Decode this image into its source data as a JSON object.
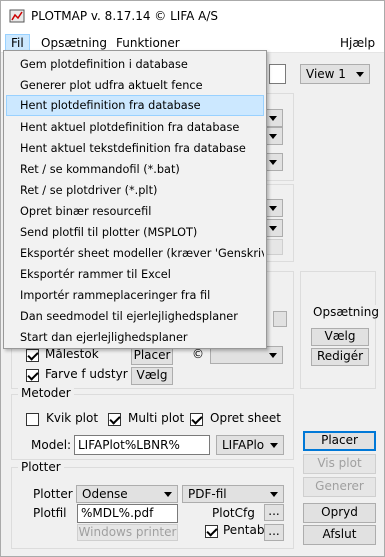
{
  "app": {
    "title": "PLOTMAP v. 8.17.14 © LIFA A/S"
  },
  "menu": {
    "items": [
      {
        "label": "Fil"
      },
      {
        "label": "Opsætning"
      },
      {
        "label": "Funktioner"
      }
    ],
    "help": "Hjælp"
  },
  "file_menu": {
    "items": [
      {
        "label": "Gem plotdefinition i database"
      },
      {
        "label": "Generer plot udfra aktuelt fence"
      },
      {
        "label": "Hent plotdefinition fra database"
      },
      {
        "label": "Hent aktuel plotdefinition fra database"
      },
      {
        "label": "Hent aktuel tekstdefinition fra database"
      },
      {
        "label": "Ret / se kommandofil (*.bat)"
      },
      {
        "label": "Ret / se plotdriver (*.plt)"
      },
      {
        "label": "Opret binær resourcefil"
      },
      {
        "label": "Send plotfil til plotter (MSPLOT)"
      },
      {
        "label": "Eksportér sheet modeller (kræver 'Genskriv')"
      },
      {
        "label": "Eksportér rammer til Excel"
      },
      {
        "label": "Importér rammeplaceringer fra fil"
      },
      {
        "label": "Dan seedmodel til ejerlejlighedsplaner"
      },
      {
        "label": "Start dan ejerlejlighedsplaner"
      }
    ],
    "highlighted_index": 2
  },
  "view": {
    "selected": "View 1"
  },
  "opsaetning": {
    "title": "Opsætning",
    "vaelg": "Vælg",
    "rediger": "Redigér"
  },
  "options": {
    "malestok": "Målestok",
    "placer": "Placer",
    "copyright": "©",
    "farve": "Farve f udstyr",
    "vaelg": "Vælg"
  },
  "metoder": {
    "title": "Metoder",
    "kvik": "Kvik plot",
    "multi": "Multi plot",
    "opret_sheet": "Opret sheet",
    "model_label": "Model:",
    "model_value": "LIFAPlot%LBNR%",
    "model_combo": "LIFAPlo"
  },
  "plotter": {
    "title": "Plotter",
    "plotter_label": "Plotter",
    "plotter_value": "Odense",
    "format_value": "PDF-fil",
    "plotfil_label": "Plotfil",
    "plotfil_value": "%MDL%.pdf",
    "plotcfg_label": "PlotCfg",
    "windows_printer": "Windows printer",
    "pentabel_label": "Pentabel",
    "ellipsis": "..."
  },
  "side_buttons": {
    "placer": "Placer",
    "vis_plot": "Vis plot",
    "generer": "Generer",
    "opryd": "Opryd",
    "afslut": "Afslut"
  }
}
